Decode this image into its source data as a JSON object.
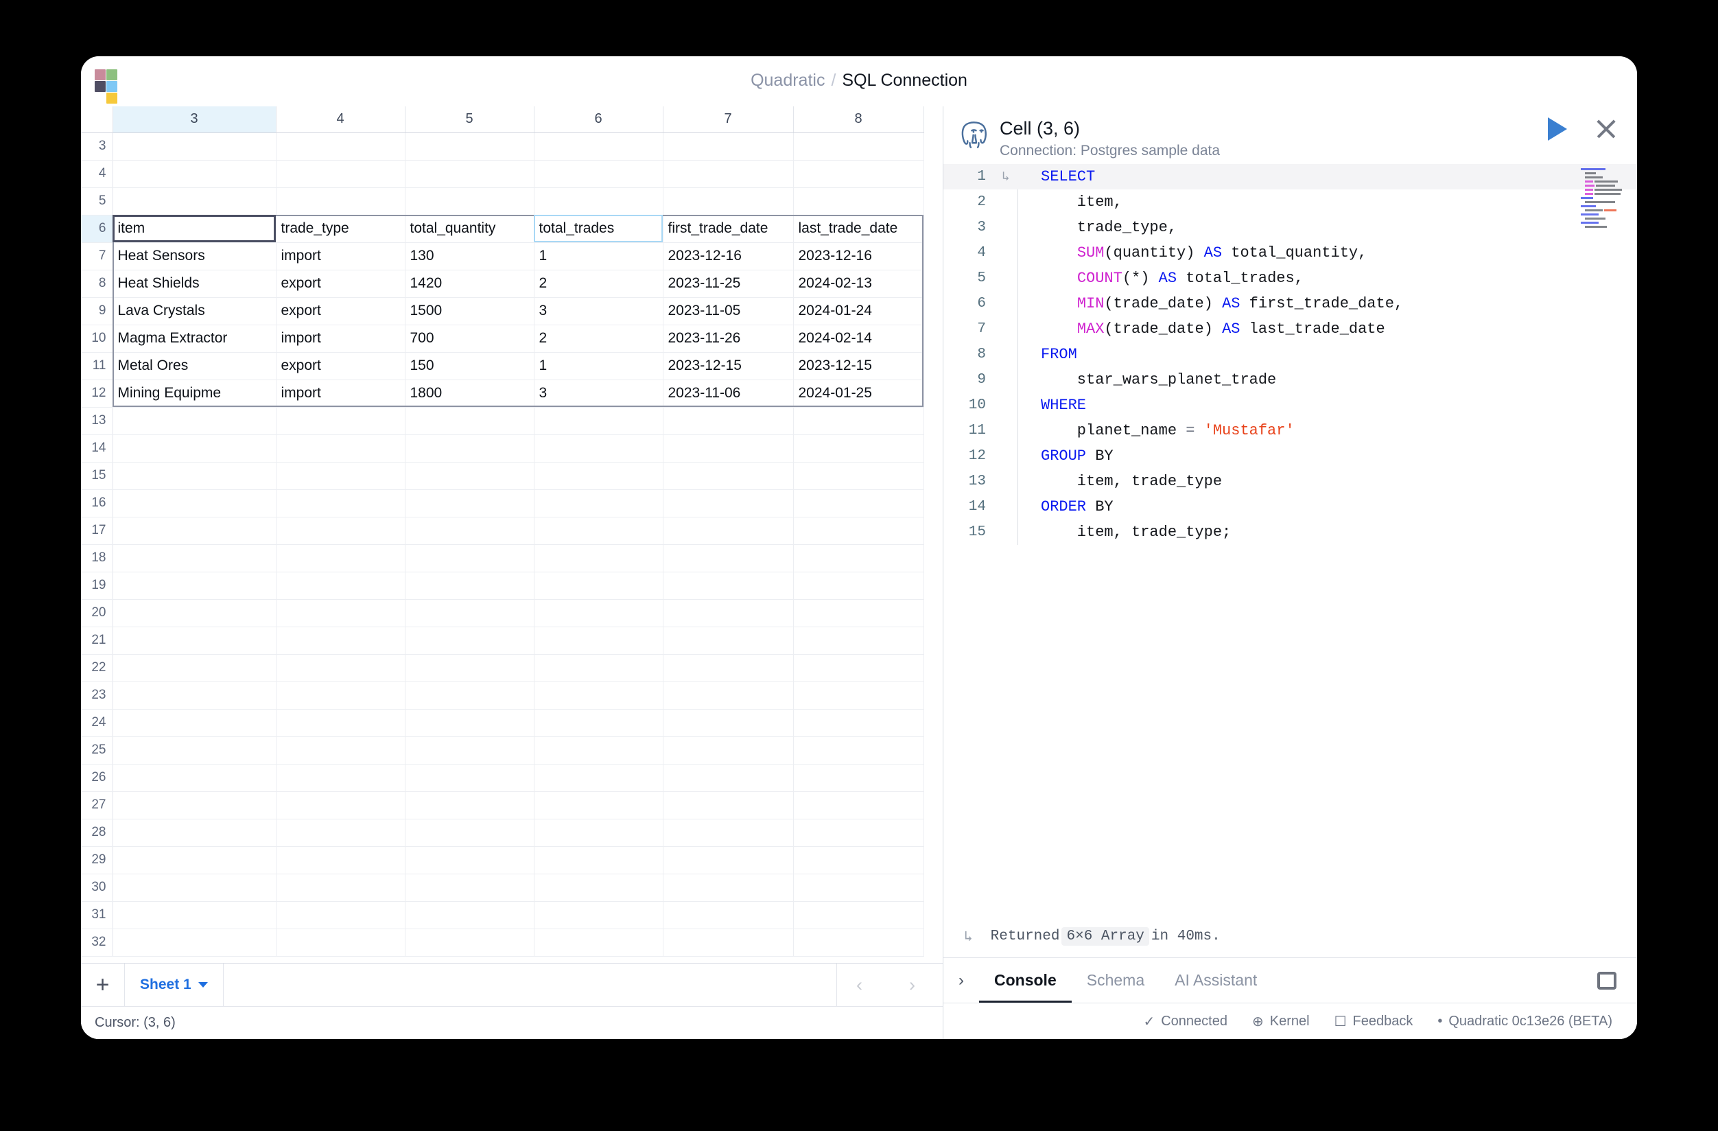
{
  "window": {
    "breadcrumb_root": "Quadratic",
    "breadcrumb_sep": "/",
    "breadcrumb_current": "SQL Connection"
  },
  "spreadsheet": {
    "column_headers": [
      "3",
      "4",
      "5",
      "6",
      "7",
      "8"
    ],
    "selected_column": "3",
    "row_numbers": [
      "3",
      "4",
      "5",
      "6",
      "7",
      "8",
      "9",
      "10",
      "11",
      "12",
      "13",
      "14",
      "15",
      "16",
      "17",
      "18",
      "19",
      "20",
      "21",
      "22",
      "23",
      "24",
      "25",
      "26",
      "27",
      "28",
      "29",
      "30",
      "31",
      "32"
    ],
    "header_row_index": 3,
    "table_headers": [
      "item",
      "trade_type",
      "total_quantity",
      "total_trades",
      "first_trade_date",
      "last_trade_date"
    ],
    "rows": [
      [
        "Heat Sensors",
        "import",
        "130",
        "1",
        "2023-12-16",
        "2023-12-16"
      ],
      [
        "Heat Shields",
        "export",
        "1420",
        "2",
        "2023-11-25",
        "2024-02-13"
      ],
      [
        "Lava Crystals",
        "export",
        "1500",
        "3",
        "2023-11-05",
        "2024-01-24"
      ],
      [
        "Magma Extractor",
        "import",
        "700",
        "2",
        "2023-11-26",
        "2024-02-14"
      ],
      [
        "Metal Ores",
        "export",
        "150",
        "1",
        "2023-12-15",
        "2023-12-15"
      ],
      [
        "Mining Equipme",
        "import",
        "1800",
        "3",
        "2023-11-06",
        "2024-01-25"
      ]
    ],
    "add_sheet_label": "+",
    "sheet_tab_label": "Sheet 1",
    "nav_prev": "‹",
    "nav_next": "›",
    "cursor_status": "Cursor: (3, 6)"
  },
  "code_panel": {
    "title": "Cell (3, 6)",
    "connection": "Connection: Postgres sample data",
    "run_icon": "play-icon",
    "close_icon": "close-icon",
    "lines": [
      {
        "n": "1",
        "fold": "↳",
        "current": true
      },
      {
        "n": "2",
        "fold": "",
        "current": false
      },
      {
        "n": "3",
        "fold": "",
        "current": false
      },
      {
        "n": "4",
        "fold": "",
        "current": false
      },
      {
        "n": "5",
        "fold": "",
        "current": false
      },
      {
        "n": "6",
        "fold": "",
        "current": false
      },
      {
        "n": "7",
        "fold": "",
        "current": false
      },
      {
        "n": "8",
        "fold": "",
        "current": false
      },
      {
        "n": "9",
        "fold": "",
        "current": false
      },
      {
        "n": "10",
        "fold": "",
        "current": false
      },
      {
        "n": "11",
        "fold": "",
        "current": false
      },
      {
        "n": "12",
        "fold": "",
        "current": false
      },
      {
        "n": "13",
        "fold": "",
        "current": false
      },
      {
        "n": "14",
        "fold": "",
        "current": false
      },
      {
        "n": "15",
        "fold": "",
        "current": false
      }
    ],
    "code_text": {
      "l1": "SELECT",
      "l2": "item,",
      "l3": "trade_type,",
      "l4_fn": "SUM",
      "l4_args": "(quantity)",
      "l4_as": "AS",
      "l4_alias": "total_quantity,",
      "l5_fn": "COUNT",
      "l5_args": "(*)",
      "l5_as": "AS",
      "l5_alias": "total_trades,",
      "l6_fn": "MIN",
      "l6_args": "(trade_date)",
      "l6_as": "AS",
      "l6_alias": "first_trade_date,",
      "l7_fn": "MAX",
      "l7_args": "(trade_date)",
      "l7_as": "AS",
      "l7_alias": "last_trade_date",
      "l8": "FROM",
      "l9": "star_wars_planet_trade",
      "l10": "WHERE",
      "l11_col": "planet_name",
      "l11_op": "=",
      "l11_str": "'Mustafar'",
      "l12_kw": "GROUP",
      "l12_by": "BY",
      "l13": "item, trade_type",
      "l14_kw": "ORDER",
      "l14_by": "BY",
      "l15": "item, trade_type;"
    }
  },
  "console": {
    "returned_arrow": "↳",
    "returned_prefix": "Returned",
    "returned_chip": "6×6 Array",
    "returned_suffix": "in 40ms.",
    "expand_icon": "›",
    "tabs": [
      {
        "label": "Console",
        "active": true
      },
      {
        "label": "Schema",
        "active": false
      },
      {
        "label": "AI Assistant",
        "active": false
      }
    ],
    "panel_toggle_icon": "panel-layout-icon"
  },
  "statusbar": {
    "items": [
      {
        "icon": "✓",
        "label": "Connected"
      },
      {
        "icon": "⊕",
        "label": "Kernel"
      },
      {
        "icon": "☐",
        "label": "Feedback"
      },
      {
        "icon": "•",
        "label": "Quadratic 0c13e26 (BETA)"
      }
    ]
  },
  "colors": {
    "accent_blue": "#1f6fe0",
    "keyword": "#0a19f0",
    "function": "#cf22cf",
    "string": "#e8421a",
    "selected_header": "#e6f3fb",
    "active_cell_border": "#4b4f63"
  }
}
